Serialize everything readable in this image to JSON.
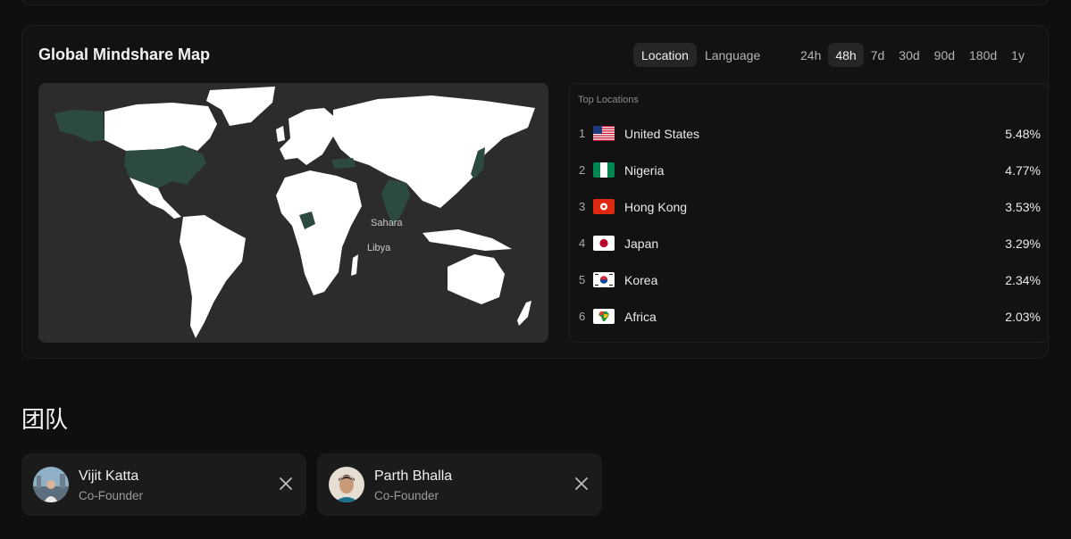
{
  "map_card": {
    "title": "Global Mindshare Map",
    "mode_tabs": [
      "Location",
      "Language"
    ],
    "active_mode": "Location",
    "time_tabs": [
      "24h",
      "48h",
      "7d",
      "30d",
      "90d",
      "180d",
      "1y"
    ],
    "active_time": "48h",
    "map_labels": {
      "sahara": "Sahara",
      "libya": "Libya"
    },
    "colors": {
      "land": "#ffffff",
      "highlight": "#2c4a40",
      "ocean": "#2c2c2c"
    }
  },
  "top_locations": {
    "title": "Top Locations",
    "items": [
      {
        "rank": "1",
        "name": "United States",
        "pct": "5.48%",
        "flag": "us-flag"
      },
      {
        "rank": "2",
        "name": "Nigeria",
        "pct": "4.77%",
        "flag": "ng-flag"
      },
      {
        "rank": "3",
        "name": "Hong Kong",
        "pct": "3.53%",
        "flag": "hk-flag"
      },
      {
        "rank": "4",
        "name": "Japan",
        "pct": "3.29%",
        "flag": "jp-flag"
      },
      {
        "rank": "5",
        "name": "Korea",
        "pct": "2.34%",
        "flag": "kr-flag"
      },
      {
        "rank": "6",
        "name": "Africa",
        "pct": "2.03%",
        "flag": "africa-flag"
      }
    ]
  },
  "team": {
    "title": "团队",
    "members": [
      {
        "name": "Vijit Katta",
        "role": "Co-Founder",
        "social": "x-icon"
      },
      {
        "name": "Parth Bhalla",
        "role": "Co-Founder",
        "social": "x-icon"
      }
    ]
  }
}
